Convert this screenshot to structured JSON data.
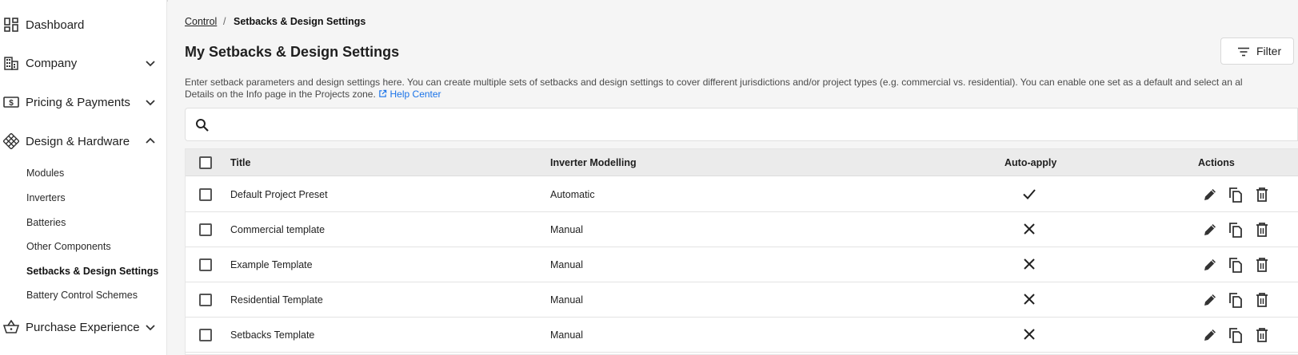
{
  "sidebar": {
    "items": [
      {
        "label": "Dashboard",
        "icon": "dashboard-icon"
      },
      {
        "label": "Company",
        "icon": "building-icon",
        "chevron": "down"
      },
      {
        "label": "Pricing & Payments",
        "icon": "dollar-bill-icon",
        "chevron": "down"
      },
      {
        "label": "Design & Hardware",
        "icon": "hardware-grid-icon",
        "chevron": "up"
      },
      {
        "label": "Purchase Experience",
        "icon": "basket-icon",
        "chevron": "down"
      }
    ],
    "sub_items": [
      {
        "label": "Modules",
        "active": false
      },
      {
        "label": "Inverters",
        "active": false
      },
      {
        "label": "Batteries",
        "active": false
      },
      {
        "label": "Other Components",
        "active": false
      },
      {
        "label": "Setbacks & Design Settings",
        "active": true
      },
      {
        "label": "Battery Control Schemes",
        "active": false
      }
    ]
  },
  "breadcrumb": {
    "parent": "Control",
    "separator": "/",
    "current": "Setbacks & Design Settings"
  },
  "page": {
    "title": "My Setbacks & Design Settings",
    "filter_label": "Filter",
    "description_line1": "Enter setback parameters and design settings here. You can create multiple sets of setbacks and design settings to cover different jurisdictions and/or project types (e.g. commercial vs. residential). You can enable one set as a default and select an al",
    "description_line2": "Details on the Info page in the Projects zone.",
    "help_link": "Help Center"
  },
  "search": {
    "value": "",
    "placeholder": ""
  },
  "table": {
    "headers": {
      "title": "Title",
      "inverter": "Inverter Modelling",
      "auto_apply": "Auto-apply",
      "actions": "Actions"
    },
    "rows": [
      {
        "title": "Default Project Preset",
        "inverter": "Automatic",
        "auto_apply": true
      },
      {
        "title": "Commercial template",
        "inverter": "Manual",
        "auto_apply": false
      },
      {
        "title": "Example Template",
        "inverter": "Manual",
        "auto_apply": false
      },
      {
        "title": "Residential Template",
        "inverter": "Manual",
        "auto_apply": false
      },
      {
        "title": "Setbacks Template",
        "inverter": "Manual",
        "auto_apply": false
      }
    ]
  },
  "colors": {
    "link": "#1a73e8",
    "sidebar_bg": "#ffffff",
    "page_bg": "#f5f5f5",
    "header_bg": "#ebebeb"
  }
}
